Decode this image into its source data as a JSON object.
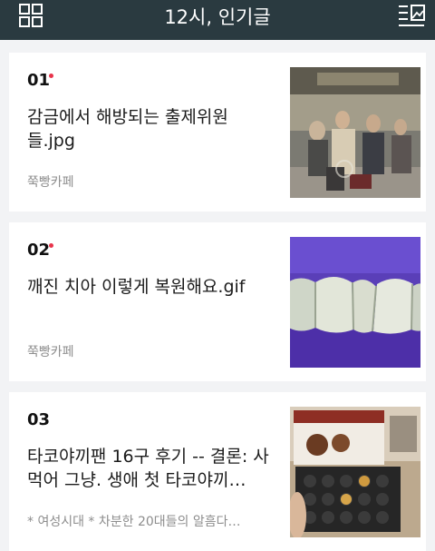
{
  "header": {
    "title": "12시, 인기글",
    "menu_icon": "grid-icon",
    "view_icon": "list-view-icon"
  },
  "posts": [
    {
      "rank": "01",
      "hot": true,
      "title": "감금에서 해방되는 출제위원들.jpg",
      "cafe": "쭉빵카페",
      "thumbnail": "photo-crowd-station"
    },
    {
      "rank": "02",
      "hot": true,
      "title": "깨진 치아 이렇게 복원해요.gif",
      "cafe": "쭉빵카페",
      "thumbnail": "photo-teeth"
    },
    {
      "rank": "03",
      "hot": false,
      "title": "타코야끼팬 16구 후기 -- 결론: 사먹어 그냥. 생애 첫 타코야끼…",
      "cafe": "* 여성시대 *  차분한 20대들의 알흠다…",
      "thumbnail": "photo-takoyaki-pan"
    }
  ],
  "colors": {
    "header_bg": "#2a3a40",
    "hot_dot": "#e8344b"
  }
}
